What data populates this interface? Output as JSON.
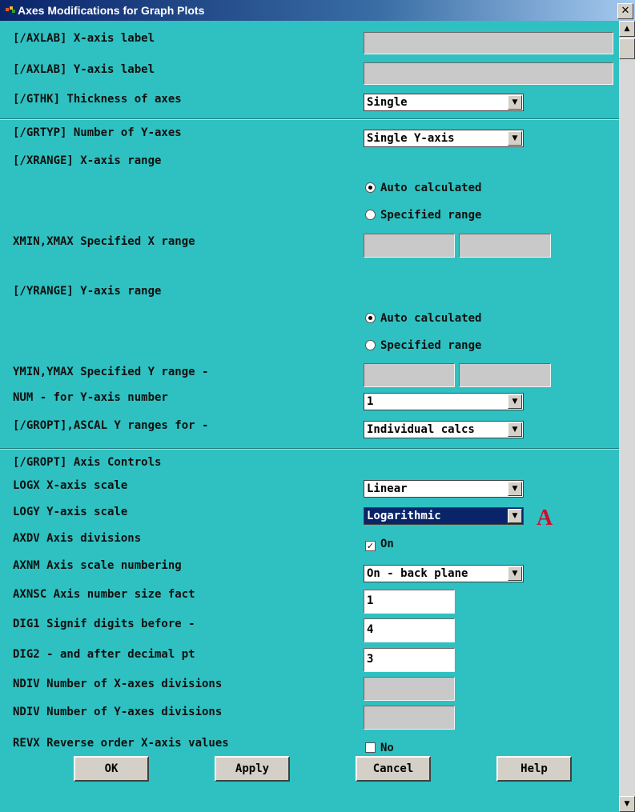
{
  "window": {
    "title": "Axes Modifications for Graph Plots",
    "close": "✕"
  },
  "axlab_x": {
    "label": "[/AXLAB]  X-axis label",
    "value": ""
  },
  "axlab_y": {
    "label": "[/AXLAB]  Y-axis label",
    "value": ""
  },
  "gthk": {
    "label": "[/GTHK]   Thickness of axes",
    "value": "Single"
  },
  "grtyp": {
    "label": "[/GRTYP]  Number of Y-axes",
    "value": "Single Y-axis"
  },
  "xrange": {
    "label": "[/XRANGE]  X-axis range",
    "auto": "Auto calculated",
    "specified": "Specified range",
    "minmax_label": "XMIN,XMAX  Specified X range",
    "xmin": "",
    "xmax": ""
  },
  "yrange": {
    "label": "[/YRANGE]  Y-axis range",
    "auto": "Auto calculated",
    "specified": "Specified range",
    "minmax_label": "YMIN,YMAX  Specified Y range -",
    "ymin": "",
    "ymax": ""
  },
  "num": {
    "label": "NUM        - for Y-axis number",
    "value": "1"
  },
  "gropt_ascal": {
    "label": "[/GROPT],ASCAL  Y ranges for -",
    "value": "Individual calcs"
  },
  "axis_controls": {
    "label": "[/GROPT]  Axis Controls"
  },
  "logx": {
    "label": "LOGX       X-axis scale",
    "value": "Linear"
  },
  "logy": {
    "label": "LOGY       Y-axis scale",
    "value": "Logarithmic"
  },
  "marker": "A",
  "axdv": {
    "label": "AXDV       Axis divisions",
    "value": "On"
  },
  "axnm": {
    "label": "AXNM       Axis scale numbering",
    "value": "On - back plane"
  },
  "axnsc": {
    "label": "AXNSC      Axis number size fact",
    "value": "1"
  },
  "dig1": {
    "label": "DIG1       Signif digits before -",
    "value": "4"
  },
  "dig2": {
    "label": "DIG2       - and after decimal pt",
    "value": "3"
  },
  "ndiv_x": {
    "label": "NDIV Number of X-axes divisions",
    "value": ""
  },
  "ndiv_y": {
    "label": "NDIV Number of Y-axes divisions",
    "value": ""
  },
  "revx": {
    "label": "REVX Reverse order X-axis values",
    "value": "No"
  },
  "buttons": {
    "ok": "OK",
    "apply": "Apply",
    "cancel": "Cancel",
    "help": "Help"
  },
  "scroll": {
    "up": "▲",
    "down": "▼"
  },
  "dropdown_arrow": "▼",
  "checkmark": "✓"
}
